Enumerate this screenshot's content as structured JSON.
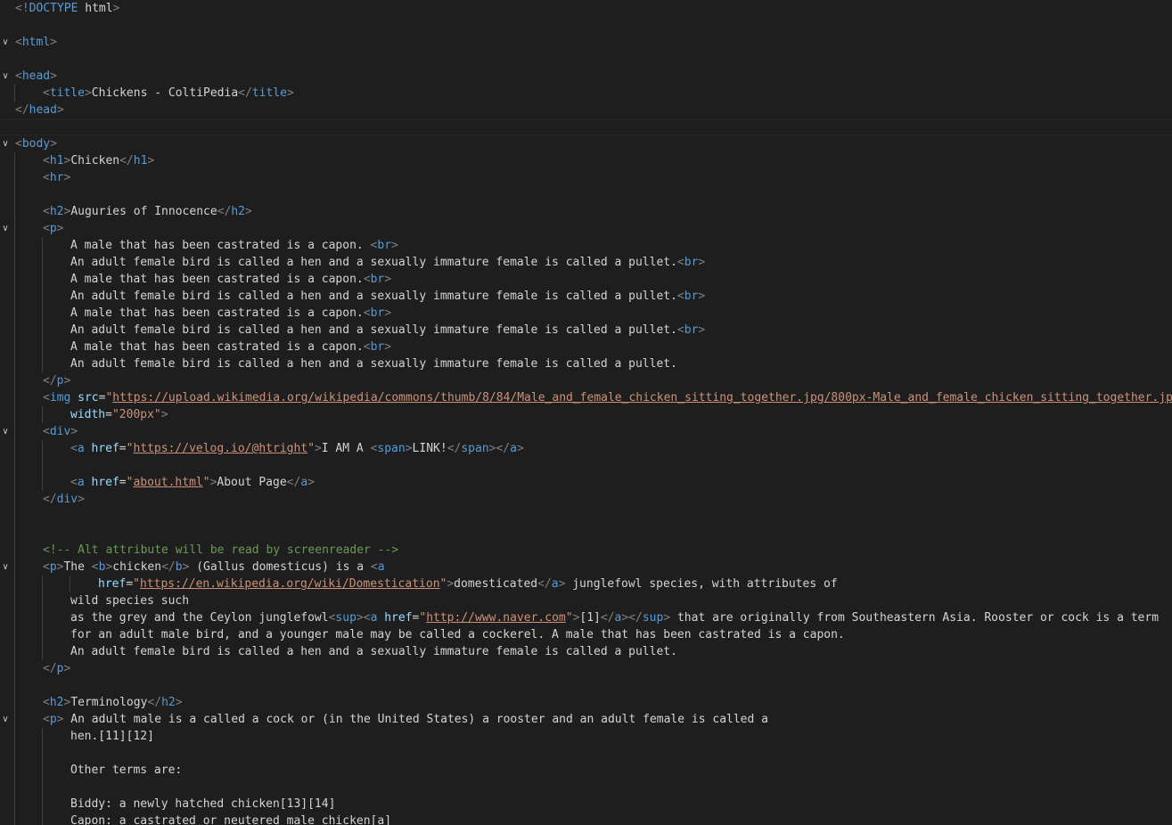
{
  "editor": {
    "language": "html",
    "lines": [
      {
        "fold": false,
        "indent": 0,
        "tokens": [
          [
            "d",
            "<!"
          ],
          [
            "n",
            "DOCTYPE"
          ],
          [
            "x",
            " html"
          ],
          [
            "d",
            ">"
          ]
        ]
      },
      {
        "fold": false,
        "indent": 0,
        "tokens": []
      },
      {
        "fold": true,
        "indent": 0,
        "tokens": [
          [
            "d",
            "<"
          ],
          [
            "n",
            "html"
          ],
          [
            "d",
            ">"
          ]
        ]
      },
      {
        "fold": false,
        "indent": 0,
        "tokens": []
      },
      {
        "fold": true,
        "indent": 0,
        "tokens": [
          [
            "d",
            "<"
          ],
          [
            "n",
            "head"
          ],
          [
            "d",
            ">"
          ]
        ]
      },
      {
        "fold": false,
        "indent": 1,
        "tokens": [
          [
            "d",
            "<"
          ],
          [
            "n",
            "title"
          ],
          [
            "d",
            ">"
          ],
          [
            "x",
            "Chickens - ColtiPedia"
          ],
          [
            "d",
            "</"
          ],
          [
            "n",
            "title"
          ],
          [
            "d",
            ">"
          ]
        ]
      },
      {
        "fold": false,
        "indent": 0,
        "tokens": [
          [
            "d",
            "</"
          ],
          [
            "n",
            "head"
          ],
          [
            "d",
            ">"
          ]
        ]
      },
      {
        "fold": false,
        "indent": 0,
        "current": true,
        "tokens": []
      },
      {
        "fold": true,
        "indent": 0,
        "tokens": [
          [
            "d",
            "<"
          ],
          [
            "n",
            "body"
          ],
          [
            "d",
            ">"
          ]
        ]
      },
      {
        "fold": false,
        "indent": 1,
        "tokens": [
          [
            "d",
            "<"
          ],
          [
            "n",
            "h1"
          ],
          [
            "d",
            ">"
          ],
          [
            "x",
            "Chicken"
          ],
          [
            "d",
            "</"
          ],
          [
            "n",
            "h1"
          ],
          [
            "d",
            ">"
          ]
        ]
      },
      {
        "fold": false,
        "indent": 1,
        "tokens": [
          [
            "d",
            "<"
          ],
          [
            "n",
            "hr"
          ],
          [
            "d",
            ">"
          ]
        ]
      },
      {
        "fold": false,
        "indent": 1,
        "tokens": []
      },
      {
        "fold": false,
        "indent": 1,
        "tokens": [
          [
            "d",
            "<"
          ],
          [
            "n",
            "h2"
          ],
          [
            "d",
            ">"
          ],
          [
            "x",
            "Auguries of Innocence"
          ],
          [
            "d",
            "</"
          ],
          [
            "n",
            "h2"
          ],
          [
            "d",
            ">"
          ]
        ]
      },
      {
        "fold": true,
        "indent": 1,
        "tokens": [
          [
            "d",
            "<"
          ],
          [
            "n",
            "p"
          ],
          [
            "d",
            ">"
          ]
        ]
      },
      {
        "fold": false,
        "indent": 2,
        "tokens": [
          [
            "x",
            "A male that has been castrated is a capon. "
          ],
          [
            "d",
            "<"
          ],
          [
            "n",
            "br"
          ],
          [
            "d",
            ">"
          ]
        ]
      },
      {
        "fold": false,
        "indent": 2,
        "tokens": [
          [
            "x",
            "An adult female bird is called a hen and a sexually immature female is called a pullet."
          ],
          [
            "d",
            "<"
          ],
          [
            "n",
            "br"
          ],
          [
            "d",
            ">"
          ]
        ]
      },
      {
        "fold": false,
        "indent": 2,
        "tokens": [
          [
            "x",
            "A male that has been castrated is a capon."
          ],
          [
            "d",
            "<"
          ],
          [
            "n",
            "br"
          ],
          [
            "d",
            ">"
          ]
        ]
      },
      {
        "fold": false,
        "indent": 2,
        "tokens": [
          [
            "x",
            "An adult female bird is called a hen and a sexually immature female is called a pullet."
          ],
          [
            "d",
            "<"
          ],
          [
            "n",
            "br"
          ],
          [
            "d",
            ">"
          ]
        ]
      },
      {
        "fold": false,
        "indent": 2,
        "tokens": [
          [
            "x",
            "A male that has been castrated is a capon."
          ],
          [
            "d",
            "<"
          ],
          [
            "n",
            "br"
          ],
          [
            "d",
            ">"
          ]
        ]
      },
      {
        "fold": false,
        "indent": 2,
        "tokens": [
          [
            "x",
            "An adult female bird is called a hen and a sexually immature female is called a pullet."
          ],
          [
            "d",
            "<"
          ],
          [
            "n",
            "br"
          ],
          [
            "d",
            ">"
          ]
        ]
      },
      {
        "fold": false,
        "indent": 2,
        "tokens": [
          [
            "x",
            "A male that has been castrated is a capon."
          ],
          [
            "d",
            "<"
          ],
          [
            "n",
            "br"
          ],
          [
            "d",
            ">"
          ]
        ]
      },
      {
        "fold": false,
        "indent": 2,
        "tokens": [
          [
            "x",
            "An adult female bird is called a hen and a sexually immature female is called a pullet."
          ]
        ]
      },
      {
        "fold": false,
        "indent": 1,
        "tokens": [
          [
            "d",
            "</"
          ],
          [
            "n",
            "p"
          ],
          [
            "d",
            ">"
          ]
        ]
      },
      {
        "fold": false,
        "indent": 1,
        "tokens": [
          [
            "d",
            "<"
          ],
          [
            "n",
            "img"
          ],
          [
            "x",
            " "
          ],
          [
            "a",
            "src"
          ],
          [
            "x",
            "="
          ],
          [
            "s",
            "\""
          ],
          [
            "u",
            "https://upload.wikimedia.org/wikipedia/commons/thumb/8/84/Male_and_female_chicken_sitting_together.jpg/800px-Male_and_female_chicken_sitting_together.jpg"
          ],
          [
            "s",
            "\""
          ]
        ]
      },
      {
        "fold": false,
        "indent": 2,
        "tokens": [
          [
            "a",
            "width"
          ],
          [
            "x",
            "="
          ],
          [
            "s",
            "\"200px\""
          ],
          [
            "d",
            ">"
          ]
        ]
      },
      {
        "fold": true,
        "indent": 1,
        "tokens": [
          [
            "d",
            "<"
          ],
          [
            "n",
            "div"
          ],
          [
            "d",
            ">"
          ]
        ]
      },
      {
        "fold": false,
        "indent": 2,
        "tokens": [
          [
            "d",
            "<"
          ],
          [
            "n",
            "a"
          ],
          [
            "x",
            " "
          ],
          [
            "a",
            "href"
          ],
          [
            "x",
            "="
          ],
          [
            "s",
            "\""
          ],
          [
            "u",
            "https://velog.io/@htright"
          ],
          [
            "s",
            "\""
          ],
          [
            "d",
            ">"
          ],
          [
            "x",
            "I AM A "
          ],
          [
            "d",
            "<"
          ],
          [
            "n",
            "span"
          ],
          [
            "d",
            ">"
          ],
          [
            "x",
            "LINK!"
          ],
          [
            "d",
            "</"
          ],
          [
            "n",
            "span"
          ],
          [
            "d",
            "></"
          ],
          [
            "n",
            "a"
          ],
          [
            "d",
            ">"
          ]
        ]
      },
      {
        "fold": false,
        "indent": 2,
        "tokens": []
      },
      {
        "fold": false,
        "indent": 2,
        "tokens": [
          [
            "d",
            "<"
          ],
          [
            "n",
            "a"
          ],
          [
            "x",
            " "
          ],
          [
            "a",
            "href"
          ],
          [
            "x",
            "="
          ],
          [
            "s",
            "\""
          ],
          [
            "u",
            "about.html"
          ],
          [
            "s",
            "\""
          ],
          [
            "d",
            ">"
          ],
          [
            "x",
            "About Page"
          ],
          [
            "d",
            "</"
          ],
          [
            "n",
            "a"
          ],
          [
            "d",
            ">"
          ]
        ]
      },
      {
        "fold": false,
        "indent": 1,
        "tokens": [
          [
            "d",
            "</"
          ],
          [
            "n",
            "div"
          ],
          [
            "d",
            ">"
          ]
        ]
      },
      {
        "fold": false,
        "indent": 1,
        "tokens": []
      },
      {
        "fold": false,
        "indent": 1,
        "tokens": []
      },
      {
        "fold": false,
        "indent": 1,
        "tokens": [
          [
            "c",
            "<!-- Alt attribute will be read by screenreader -->"
          ]
        ]
      },
      {
        "fold": true,
        "indent": 1,
        "tokens": [
          [
            "d",
            "<"
          ],
          [
            "n",
            "p"
          ],
          [
            "d",
            ">"
          ],
          [
            "x",
            "The "
          ],
          [
            "d",
            "<"
          ],
          [
            "n",
            "b"
          ],
          [
            "d",
            ">"
          ],
          [
            "x",
            "chicken"
          ],
          [
            "d",
            "</"
          ],
          [
            "n",
            "b"
          ],
          [
            "d",
            ">"
          ],
          [
            "x",
            " (Gallus domesticus) is a "
          ],
          [
            "d",
            "<"
          ],
          [
            "n",
            "a"
          ]
        ]
      },
      {
        "fold": false,
        "indent": 3,
        "tokens": [
          [
            "a",
            "href"
          ],
          [
            "x",
            "="
          ],
          [
            "s",
            "\""
          ],
          [
            "u",
            "https://en.wikipedia.org/wiki/Domestication"
          ],
          [
            "s",
            "\""
          ],
          [
            "d",
            ">"
          ],
          [
            "x",
            "domesticated"
          ],
          [
            "d",
            "</"
          ],
          [
            "n",
            "a"
          ],
          [
            "d",
            ">"
          ],
          [
            "x",
            " junglefowl species, with attributes of"
          ]
        ]
      },
      {
        "fold": false,
        "indent": 2,
        "tokens": [
          [
            "x",
            "wild species such"
          ]
        ]
      },
      {
        "fold": false,
        "indent": 2,
        "tokens": [
          [
            "x",
            "as the grey and the Ceylon junglefowl"
          ],
          [
            "d",
            "<"
          ],
          [
            "n",
            "sup"
          ],
          [
            "d",
            "><"
          ],
          [
            "n",
            "a"
          ],
          [
            "x",
            " "
          ],
          [
            "a",
            "href"
          ],
          [
            "x",
            "="
          ],
          [
            "s",
            "\""
          ],
          [
            "u",
            "http://www.naver.com"
          ],
          [
            "s",
            "\""
          ],
          [
            "d",
            ">"
          ],
          [
            "x",
            "[1]"
          ],
          [
            "d",
            "</"
          ],
          [
            "n",
            "a"
          ],
          [
            "d",
            "></"
          ],
          [
            "n",
            "sup"
          ],
          [
            "d",
            ">"
          ],
          [
            "x",
            " that are originally from Southeastern Asia. Rooster or cock is a term"
          ]
        ]
      },
      {
        "fold": false,
        "indent": 2,
        "tokens": [
          [
            "x",
            "for an adult male bird, and a younger male may be called a cockerel. A male that has been castrated is a capon."
          ]
        ]
      },
      {
        "fold": false,
        "indent": 2,
        "tokens": [
          [
            "x",
            "An adult female bird is called a hen and a sexually immature female is called a pullet."
          ]
        ]
      },
      {
        "fold": false,
        "indent": 1,
        "tokens": [
          [
            "d",
            "</"
          ],
          [
            "n",
            "p"
          ],
          [
            "d",
            ">"
          ]
        ]
      },
      {
        "fold": false,
        "indent": 1,
        "tokens": []
      },
      {
        "fold": false,
        "indent": 1,
        "tokens": [
          [
            "d",
            "<"
          ],
          [
            "n",
            "h2"
          ],
          [
            "d",
            ">"
          ],
          [
            "x",
            "Terminology"
          ],
          [
            "d",
            "</"
          ],
          [
            "n",
            "h2"
          ],
          [
            "d",
            ">"
          ]
        ]
      },
      {
        "fold": true,
        "indent": 1,
        "tokens": [
          [
            "d",
            "<"
          ],
          [
            "n",
            "p"
          ],
          [
            "d",
            ">"
          ],
          [
            "x",
            " An adult male is a called a cock or (in the United States) a rooster and an adult female is called a"
          ]
        ]
      },
      {
        "fold": false,
        "indent": 2,
        "tokens": [
          [
            "x",
            "hen.[11][12]"
          ]
        ]
      },
      {
        "fold": false,
        "indent": 2,
        "tokens": []
      },
      {
        "fold": false,
        "indent": 2,
        "tokens": [
          [
            "x",
            "Other terms are:"
          ]
        ]
      },
      {
        "fold": false,
        "indent": 2,
        "tokens": []
      },
      {
        "fold": false,
        "indent": 2,
        "tokens": [
          [
            "x",
            "Biddy: a newly hatched chicken[13][14]"
          ]
        ]
      },
      {
        "fold": false,
        "indent": 2,
        "tokens": [
          [
            "x",
            "Capon: a castrated or neutered male chicken[a]"
          ]
        ]
      }
    ]
  }
}
